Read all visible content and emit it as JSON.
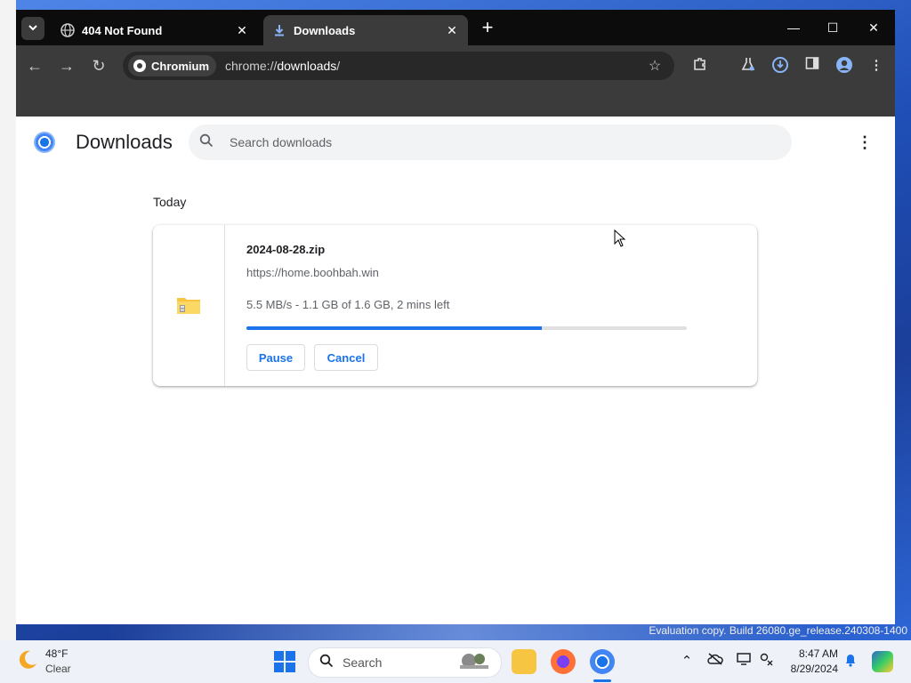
{
  "browser": {
    "tabs": [
      {
        "title": "404 Not Found",
        "favicon": "globe-icon",
        "active": false
      },
      {
        "title": "Downloads",
        "favicon": "download-icon",
        "active": true
      }
    ],
    "omnibox": {
      "chip_label": "Chromium",
      "url_prefix": "chrome://",
      "url_host": "downloads",
      "url_suffix": "/"
    }
  },
  "downloads_page": {
    "title": "Downloads",
    "search_placeholder": "Search downloads",
    "section_label": "Today",
    "items": [
      {
        "file_name": "2024-08-28.zip",
        "source_url": "https://home.boohbah.win",
        "status": "5.5 MB/s - 1.1 GB of 1.6 GB, 2 mins left",
        "progress_fraction": 0.67,
        "pause_label": "Pause",
        "cancel_label": "Cancel"
      }
    ]
  },
  "taskbar": {
    "weather_temp": "48°F",
    "weather_condition": "Clear",
    "search_label": "Search",
    "clock_time": "8:47 AM",
    "clock_date": "8/29/2024"
  },
  "desktop": {
    "watermark": "Evaluation copy. Build 26080.ge_release.240308-1400"
  },
  "colors": {
    "accent": "#1a73e8",
    "tabstrip_bg": "#0c0c0c",
    "toolbar_bg": "#3b3b3b"
  }
}
